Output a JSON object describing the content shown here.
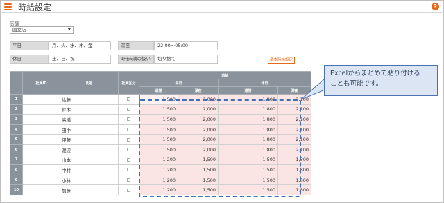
{
  "header": {
    "title": "時給設定",
    "menu_icon": "hamburger-icon",
    "help_icon": "help-icon",
    "help_glyph": "?"
  },
  "store": {
    "label": "店舗",
    "selected": "国立店"
  },
  "settings": {
    "weekday_label": "平日",
    "weekday_value": "月、火、水、木、金",
    "holiday_label": "休日",
    "holiday_value": "土、日、祝",
    "latenight_label": "深夜",
    "latenight_value": "22:00～05:00",
    "rounding_label": "1円未満の扱い",
    "rounding_value": "切り捨て",
    "basic_button": "基本時給設定"
  },
  "table": {
    "headers": {
      "employee_id": "社員ID",
      "name": "氏名",
      "employee_flag": "社員区分",
      "hourly_wage": "時給",
      "weekday": "平日",
      "holiday": "休日",
      "regular": "通常",
      "latenight": "深夜"
    },
    "rows": [
      {
        "no": "1",
        "name": "佐藤",
        "wd_reg": "1,500",
        "wd_night": "2,000",
        "hd_reg": "1,800",
        "hd_night": "2,100"
      },
      {
        "no": "2",
        "name": "鈴木",
        "wd_reg": "1,500",
        "wd_night": "2,000",
        "hd_reg": "1,800",
        "hd_night": "2,100"
      },
      {
        "no": "3",
        "name": "高橋",
        "wd_reg": "1,500",
        "wd_night": "2,000",
        "hd_reg": "1,800",
        "hd_night": "2,100"
      },
      {
        "no": "4",
        "name": "田中",
        "wd_reg": "1,500",
        "wd_night": "2,000",
        "hd_reg": "1,800",
        "hd_night": "2,100"
      },
      {
        "no": "5",
        "name": "伊藤",
        "wd_reg": "1,500",
        "wd_night": "2,000",
        "hd_reg": "1,800",
        "hd_night": "2,100"
      },
      {
        "no": "6",
        "name": "渡辺",
        "wd_reg": "1,500",
        "wd_night": "2,000",
        "hd_reg": "1,800",
        "hd_night": "2,100"
      },
      {
        "no": "7",
        "name": "山本",
        "wd_reg": "1,200",
        "wd_night": "1,500",
        "hd_reg": "1,500",
        "hd_night": "1,800"
      },
      {
        "no": "8",
        "name": "中村",
        "wd_reg": "1,200",
        "wd_night": "1,500",
        "hd_reg": "1,500",
        "hd_night": "1,800"
      },
      {
        "no": "9",
        "name": "小林",
        "wd_reg": "1,200",
        "wd_night": "1,500",
        "hd_reg": "1,500",
        "hd_night": "1,800"
      },
      {
        "no": "10",
        "name": "加藤",
        "wd_reg": "1,200",
        "wd_night": "1,500",
        "hd_reg": "1,500",
        "hd_night": "1,800"
      }
    ]
  },
  "callout": {
    "line1": "Excelからまとめて貼り付ける",
    "line2": "ことも可能です。"
  },
  "colors": {
    "accent": "#e8691c",
    "header_gray": "#8a939c",
    "wage_cell": "#fbe4e4",
    "dash_blue": "#3f6fb5",
    "callout_bg": "#dbe5f3"
  }
}
